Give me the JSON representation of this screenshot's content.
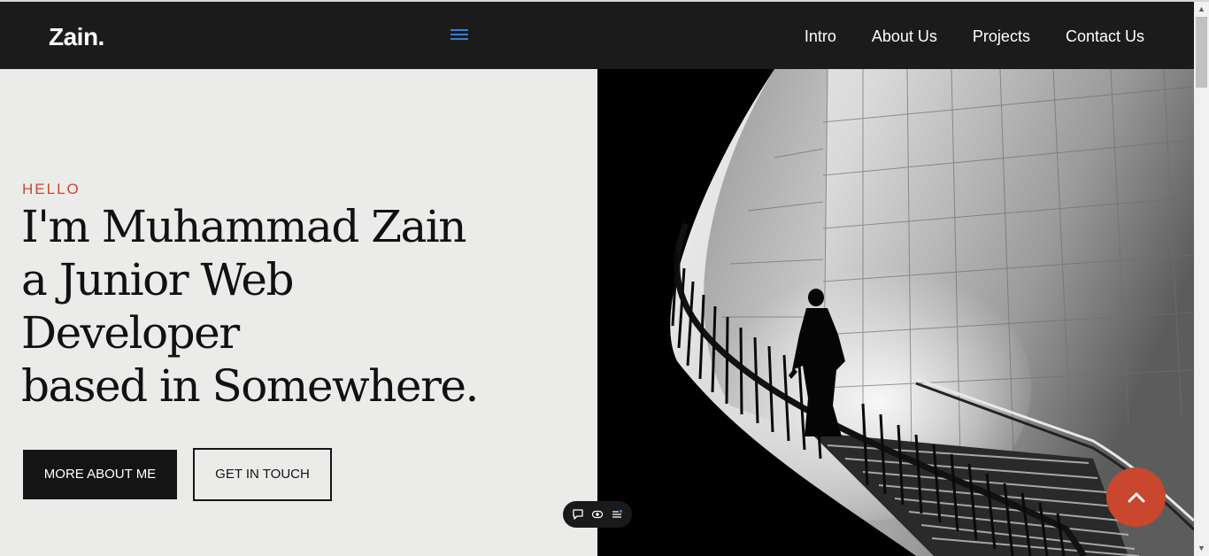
{
  "header": {
    "logo": "Zain.",
    "nav": [
      "Intro",
      "About Us",
      "Projects",
      "Contact Us"
    ]
  },
  "hero": {
    "eyebrow": "HELLO",
    "headline_lines": [
      "I'm Muhammad Zain",
      "a Junior Web",
      "Developer",
      "based in Somewhere."
    ],
    "primary_button": "MORE ABOUT ME",
    "secondary_button": "GET IN TOUCH"
  },
  "icons": {
    "menu": "hamburger-menu-icon",
    "widget": [
      "chat-bubble-icon",
      "eye-icon",
      "list-settings-icon"
    ],
    "scroll_top": "chevron-up-icon"
  },
  "colors": {
    "header_bg": "#1b1b1b",
    "accent": "#c9472f",
    "hero_bg": "#ebecea",
    "menu_icon": "#3a7bd5"
  }
}
